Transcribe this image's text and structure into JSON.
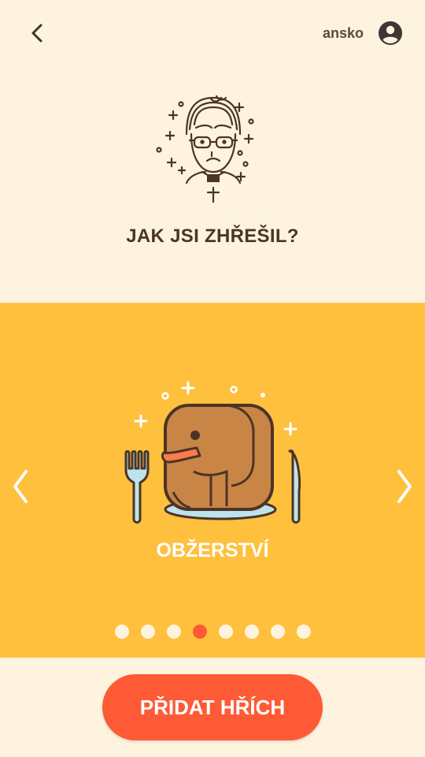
{
  "header": {
    "back_icon": "chevron-left-icon",
    "username": "ansko",
    "account_icon": "account-circle-icon"
  },
  "hero": {
    "icon": "priest-icon",
    "question": "JAK JSI ZHŘEŠIL?"
  },
  "carousel": {
    "prev_icon": "chevron-left-icon",
    "next_icon": "chevron-right-icon",
    "current_sin": {
      "icon": "elephant-plate-icon",
      "label": "OBŽERSTVÍ"
    },
    "page_count": 8,
    "active_index": 3
  },
  "actions": {
    "add_label": "PŘIDAT HŘÍCH"
  },
  "colors": {
    "background": "#FEF3DE",
    "carousel": "#FEC03D",
    "accent": "#FF5A36",
    "text_dark": "#4B3428"
  }
}
